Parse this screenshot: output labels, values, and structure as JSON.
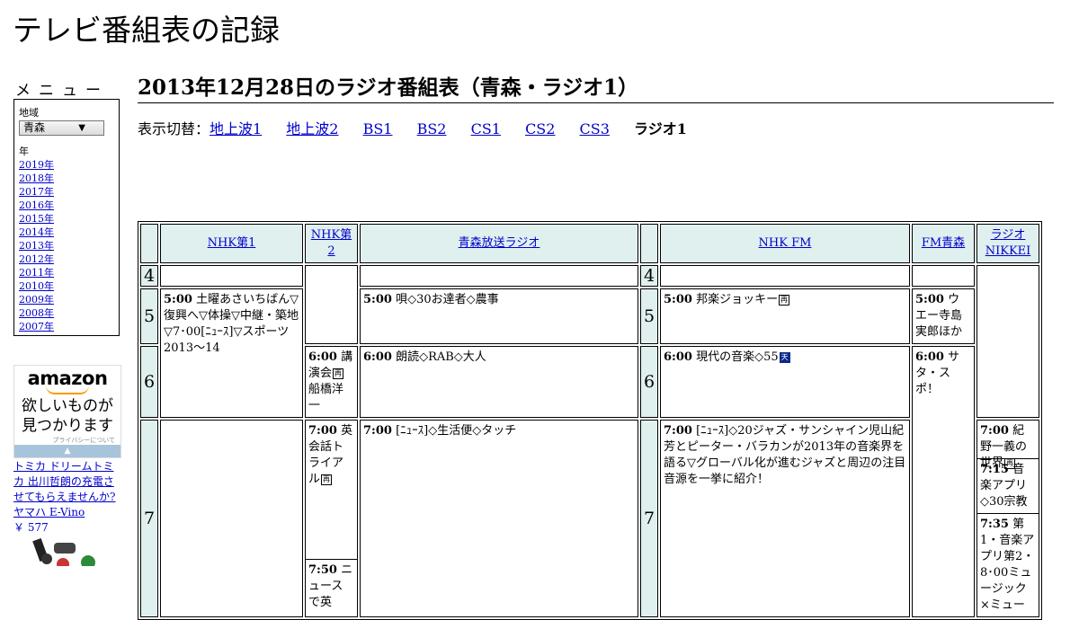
{
  "site": {
    "title": "テレビ番組表の記録"
  },
  "sidebar": {
    "menu_title": "メニュー",
    "region_label": "地域",
    "region_value": "青森",
    "year_label": "年",
    "years": [
      "2019年",
      "2018年",
      "2017年",
      "2016年",
      "2015年",
      "2014年",
      "2013年",
      "2012年",
      "2011年",
      "2010年",
      "2009年",
      "2008年",
      "2007年"
    ]
  },
  "ad": {
    "logo": "amazon",
    "text1": "欲しいものが",
    "text2": "見つかります",
    "privacy": "プライバシーについて",
    "links": [
      "トミカ ドリームトミカ 出川哲朗の充電させてもらえませんか?",
      "ヤマハ E-Vino"
    ],
    "price": "￥ 577"
  },
  "page": {
    "heading": "2013年12月28日のラジオ番組表（青森・ラジオ1）"
  },
  "switcher": {
    "prefix": "表示切替：",
    "links": [
      "地上波1",
      "地上波2",
      "BS1",
      "BS2",
      "CS1",
      "CS2",
      "CS3"
    ],
    "current": "ラジオ1"
  },
  "channels": [
    "NHK第1",
    "NHK第2",
    "青森放送ラジオ",
    "NHK FM",
    "FM青森",
    "ラジオNIKKEI"
  ],
  "hours": [
    "4",
    "5",
    "6",
    "7"
  ],
  "programs": {
    "nhk1_500_time": "5:00",
    "nhk1_500_title": "土曜あさいちばん▽復興へ▽体操▽中継・築地▽7･00[ﾆｭｰｽ]▽スポーツ2013〜14",
    "nhk2_600_time": "6:00",
    "nhk2_600_title": "講演会",
    "nhk2_600_mark": "再",
    "nhk2_600_title2": "船橋洋一",
    "nhk2_700_time": "7:00",
    "nhk2_700_title": "英会話トライアル",
    "nhk2_700_mark": "再",
    "nhk2_750_time": "7:50",
    "nhk2_750_title": "ニュースで英",
    "rab_500_time": "5:00",
    "rab_500_title": "唄◇30お達者◇農事",
    "rab_600_time": "6:00",
    "rab_600_title": "朗読◇RAB◇大人",
    "rab_700_time": "7:00",
    "rab_700_title": "[ﾆｭｰｽ]◇生活便◇タッチ",
    "fm_500_time": "5:00",
    "fm_500_title": "邦楽ジョッキー",
    "fm_500_mark": "再",
    "fm_600_time": "6:00",
    "fm_600_title": "現代の音楽◇55",
    "fm_600_mark": "天",
    "fm_700_time": "7:00",
    "fm_700_title": "[ﾆｭｰｽ]◇20ジャズ・サンシャイン児山紀芳とピーター・バラカンが2013年の音楽界を語る▽グローバル化が進むジャズと周辺の注目音源を一挙に紹介！",
    "fma_500_time": "5:00",
    "fma_500_title": "ウエー寺島実郎ほか",
    "fma_600_time": "6:00",
    "fma_600_title": "サタ・スポ！",
    "nikkei_700_time": "7:00",
    "nikkei_700_title": "紀野一義の世界",
    "nikkei_700_mark": "再",
    "nikkei_715_time": "7:15",
    "nikkei_715_title": "音楽アプリ◇30宗教",
    "nikkei_735_time": "7:35",
    "nikkei_735_title": "第1・音楽アプリ第2・8･00ミュージック×ミュー"
  },
  "colors": {
    "header_bg": "#dff0ef",
    "link": "#0000cc",
    "mark_bg": "#0a2a8a",
    "ad_accent": "#ff9900"
  }
}
